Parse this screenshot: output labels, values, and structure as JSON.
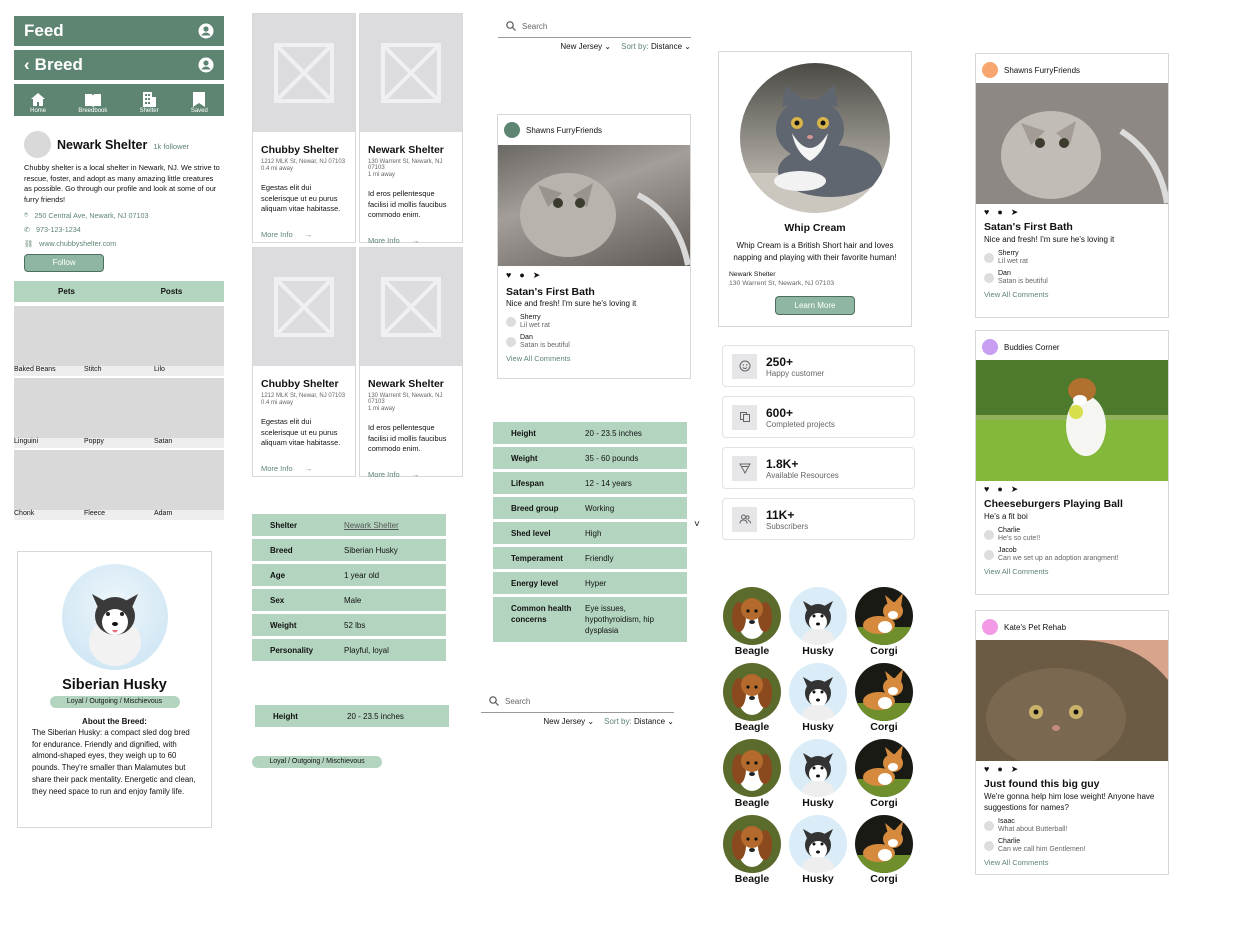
{
  "feed_header": {
    "title": "Feed"
  },
  "breed_header": {
    "title": "Breed"
  },
  "nav": [
    {
      "label": "Home",
      "icon": "home-icon"
    },
    {
      "label": "Breedbook",
      "icon": "book-icon"
    },
    {
      "label": "Shelter",
      "icon": "building-icon"
    },
    {
      "label": "Saved",
      "icon": "bookmark-icon"
    }
  ],
  "shelter_profile": {
    "name": "Newark Shelter",
    "followers": "1k follower",
    "description": "Chubby shelter is a local shelter in Newark, NJ. We strive to rescue, foster, and adopt as many amazing little creatures as possible. Go through our profile and look at some of our furry friends!",
    "address": "250 Central Ave, Newark, NJ 07103",
    "phone": "973-123-1234",
    "website": "www.chubbyshelter.com",
    "follow": "Follow",
    "tabs": [
      "Pets",
      "Posts"
    ],
    "pets": [
      [
        "Baked Beans",
        "Stitch",
        "Lilo"
      ],
      [
        "Linguini",
        "Poppy",
        "Satan"
      ],
      [
        "Chonk",
        "Fleece",
        "Adam"
      ]
    ]
  },
  "shelter_cards": [
    {
      "name": "Chubby Shelter",
      "address": "1212 MLK St, Newar, NJ 07103",
      "distance": "0.4 mi away",
      "text": "Egestas elit dui scelerisque ut eu purus aliquam vitae habitasse.",
      "more": "More Info"
    },
    {
      "name": "Newark Shelter",
      "address": "130 Warrent St, Newark, NJ 07103",
      "distance": "1 mi away",
      "text": "Id eros pellentesque facilisi id mollis faucibus commodo enim.",
      "more": "More Info"
    },
    {
      "name": "Chubby Shelter",
      "address": "1212 MLK St, Newar, NJ 07103",
      "distance": "0.4 mi away",
      "text": "Egestas elit dui scelerisque ut eu purus aliquam vitae habitasse.",
      "more": "More Info"
    },
    {
      "name": "Newark Shelter",
      "address": "130 Warrent St, Newark, NJ 07103",
      "distance": "1 mi away",
      "text": "Id eros pellentesque facilisi id mollis faucibus commodo enim.",
      "more": "More Info"
    }
  ],
  "pet_table": [
    [
      "Shelter",
      "Newark Shelter"
    ],
    [
      "Breed",
      "Siberian Husky"
    ],
    [
      "Age",
      "1 year old"
    ],
    [
      "Sex",
      "Male"
    ],
    [
      "Weight",
      "52 lbs"
    ],
    [
      "Personality",
      "Playful, loyal"
    ]
  ],
  "height_row": [
    "Height",
    "20 - 23.5 inches"
  ],
  "trait_pill": "Loyal / Outgoing / Mischievous",
  "husky": {
    "name": "Siberian Husky",
    "traits": "Loyal / Outgoing / Mischievous",
    "about_title": "About the Breed:",
    "about": "The Siberian Husky: a compact sled dog bred for endurance. Friendly and dignified, with almond-shaped eyes, they weigh up to 60 pounds. They're smaller than Malamutes but share their pack mentality. Energetic and clean, they need space to run and enjoy family life."
  },
  "search1": {
    "placeholder": "Search",
    "location": "New Jersey",
    "sort_label": "Sort by:",
    "sort_value": "Distance"
  },
  "search2": {
    "placeholder": "Search",
    "location": "New Jersey",
    "sort_label": "Sort by:",
    "sort_value": "Distance"
  },
  "post_main": {
    "user": "Shawns FurryFriends",
    "title": "Satan's First Bath",
    "caption": "Nice and fresh! I'm sure he's loving it",
    "comments": [
      {
        "name": "Sherry",
        "text": "Lil wet rat"
      },
      {
        "name": "Dan",
        "text": "Satan is beutiful"
      }
    ],
    "view_all": "View All Comments"
  },
  "breed_table": [
    [
      "Height",
      "20 - 23.5 inches"
    ],
    [
      "Weight",
      "35 - 60 pounds"
    ],
    [
      "Lifespan",
      "12 - 14 years"
    ],
    [
      "Breed group",
      "Working"
    ],
    [
      "Shed level",
      "High"
    ],
    [
      "Temperament",
      "Friendly"
    ],
    [
      "Energy level",
      "Hyper"
    ],
    [
      "Common health concerns",
      "Eye issues, hypothyroidism, hip dysplasia"
    ]
  ],
  "chevron": "˅",
  "whip": {
    "name": "Whip Cream",
    "desc": "Whip Cream is a British Short hair and loves napping and playing with their favorite human!",
    "shelter": "Newark Shelter",
    "address": "130 Warrent St, Newark, NJ 07103",
    "button": "Learn More"
  },
  "stats": [
    {
      "value": "250+",
      "label": "Happy customer",
      "icon": "smile-icon"
    },
    {
      "value": "600+",
      "label": "Completed projects",
      "icon": "copy-icon"
    },
    {
      "value": "1.8K+",
      "label": "Available Resources",
      "icon": "layers-icon"
    },
    {
      "value": "11K+",
      "label": "Subscribers",
      "icon": "users-icon"
    }
  ],
  "breeds_grid": [
    [
      "Beagle",
      "Husky",
      "Corgi"
    ],
    [
      "Beagle",
      "Husky",
      "Corgi"
    ],
    [
      "Beagle",
      "Husky",
      "Corgi"
    ],
    [
      "Beagle",
      "Husky",
      "Corgi"
    ]
  ],
  "posts": [
    {
      "user": "Shawns FurryFriends",
      "avatar_color": "#f6a66e",
      "title": "Satan's First Bath",
      "caption": "Nice and fresh! I'm sure he's loving it",
      "comments": [
        {
          "name": "Sherry",
          "text": "Lil wet rat"
        },
        {
          "name": "Dan",
          "text": "Satan is beutiful"
        }
      ],
      "view_all": "View All Comments"
    },
    {
      "user": "Buddies Corner",
      "avatar_color": "#c79ef2",
      "title": "Cheeseburgers Playing Ball",
      "caption": "He's a fit boi",
      "comments": [
        {
          "name": "Charlie",
          "text": "He's so cute!!"
        },
        {
          "name": "Jacob",
          "text": "Can we set up an adoption arangment!"
        }
      ],
      "view_all": "View All Comments"
    },
    {
      "user": "Kate's Pet Rehab",
      "avatar_color": "#f29ae6",
      "title": "Just found this big guy",
      "caption": "We're gonna help him lose weight! Anyone have suggestions for names?",
      "comments": [
        {
          "name": "Isaac",
          "text": "What about Butterball!"
        },
        {
          "name": "Charlie",
          "text": "Can we call him Gentlemen!"
        }
      ],
      "view_all": "View All Comments"
    }
  ]
}
